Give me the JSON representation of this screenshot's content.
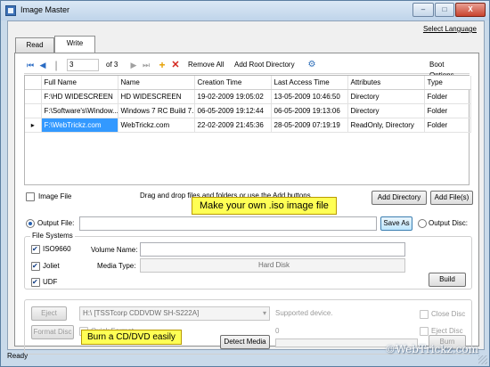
{
  "window": {
    "title": "Image Master",
    "controls": {
      "minimize": "–",
      "maximize": "□",
      "close": "X"
    },
    "select_language": "Select Language"
  },
  "tabs": {
    "read": "Read",
    "write": "Write"
  },
  "toolbar": {
    "page_value": "3",
    "page_total": "of 3",
    "remove_all": "Remove All",
    "add_root_directory": "Add Root Directory",
    "boot_options": "Boot Options"
  },
  "grid": {
    "columns": [
      "Full Name",
      "Name",
      "Creation Time",
      "Last Access Time",
      "Attributes",
      "Type"
    ],
    "rows": [
      [
        "F:\\HD WIDESCREEN",
        "HD WIDESCREEN",
        "19-02-2009 19:05:02",
        "13-05-2009 10:46:50",
        "Directory",
        "Folder"
      ],
      [
        "F:\\Software's\\Window...",
        "Windows 7 RC Build 7...",
        "06-05-2009 19:12:44",
        "06-05-2009 19:13:06",
        "Directory",
        "Folder"
      ],
      [
        "F:\\WebTrickz.com",
        "WebTrickz.com",
        "22-02-2009 21:45:36",
        "28-05-2009 07:19:19",
        "ReadOnly, Directory",
        "Folder"
      ]
    ],
    "selected_row": 2
  },
  "options": {
    "image_file_label": "Image File",
    "drag_hint": "Drag and drop files and folders or use the Add buttons.",
    "add_directory": "Add Directory",
    "add_files": "Add File(s)",
    "output_file_label": "Output File:",
    "output_file_value": "",
    "save_as": "Save As",
    "output_disc_label": "Output Disc:"
  },
  "callouts": {
    "iso": "Make your own .iso image file",
    "burn": "Burn a CD/DVD easily"
  },
  "file_systems": {
    "title": "File Systems",
    "iso9660": "ISO9660",
    "joliet": "Joliet",
    "udf": "UDF",
    "volume_name_label": "Volume Name:",
    "volume_name_value": "",
    "media_type_label": "Media Type:",
    "media_type_value": "Hard Disk",
    "build": "Build"
  },
  "disc": {
    "eject": "Eject",
    "drive": "H:\\ [TSSTcorp CDDVDW SH-S222A]",
    "supported": "Supported device.",
    "close_disc": "Close Disc",
    "format_disc": "Format Disc",
    "quick_format": "Quick Format",
    "eject_disc": "Eject Disc",
    "detect_media": "Detect Media",
    "progress_value": "0",
    "progress_fraction": 0,
    "burn": "Burn"
  },
  "status": {
    "text": "Ready"
  },
  "watermark": "©WebTrickz.com",
  "colors": {
    "selection": "#3399ff",
    "callout": "#ffff55",
    "titlebar": "#c9daea"
  }
}
